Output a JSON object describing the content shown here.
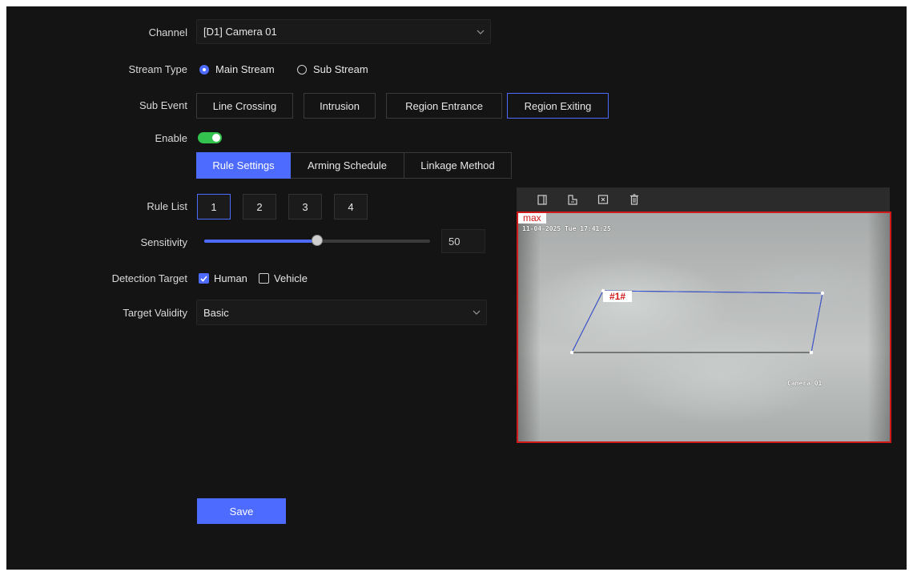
{
  "form": {
    "channel": {
      "label": "Channel",
      "value": "[D1] Camera 01"
    },
    "stream_type": {
      "label": "Stream Type",
      "options": [
        {
          "label": "Main Stream",
          "selected": true
        },
        {
          "label": "Sub Stream",
          "selected": false
        }
      ]
    },
    "sub_event": {
      "label": "Sub Event",
      "buttons": [
        "Line Crossing",
        "Intrusion",
        "Region Entrance",
        "Region Exiting"
      ],
      "active": "Region Exiting"
    },
    "enable": {
      "label": "Enable",
      "on": true
    },
    "tabs": {
      "items": [
        "Rule Settings",
        "Arming Schedule",
        "Linkage Method"
      ],
      "active": "Rule Settings"
    },
    "rule_list": {
      "label": "Rule List",
      "items": [
        "1",
        "2",
        "3",
        "4"
      ],
      "active": "1"
    },
    "sensitivity": {
      "label": "Sensitivity",
      "value": "50",
      "max": 100
    },
    "detection_target": {
      "label": "Detection Target",
      "options": [
        {
          "label": "Human",
          "checked": true
        },
        {
          "label": "Vehicle",
          "checked": false
        }
      ]
    },
    "target_validity": {
      "label": "Target Validity",
      "value": "Basic"
    },
    "save_label": "Save"
  },
  "preview": {
    "toolbar_icons": [
      "draw-area-icon",
      "full-screen-area-icon",
      "clear-icon",
      "delete-icon"
    ],
    "max_tag": "max",
    "timestamp": "11-04-2025 Tue 17:41:25",
    "camera_label": "Camera 01",
    "region_label": "#1#",
    "region_color": "#d01a1a"
  },
  "colors": {
    "accent": "#4d6bff",
    "toggle_on": "#33c24d",
    "background": "#141414"
  }
}
